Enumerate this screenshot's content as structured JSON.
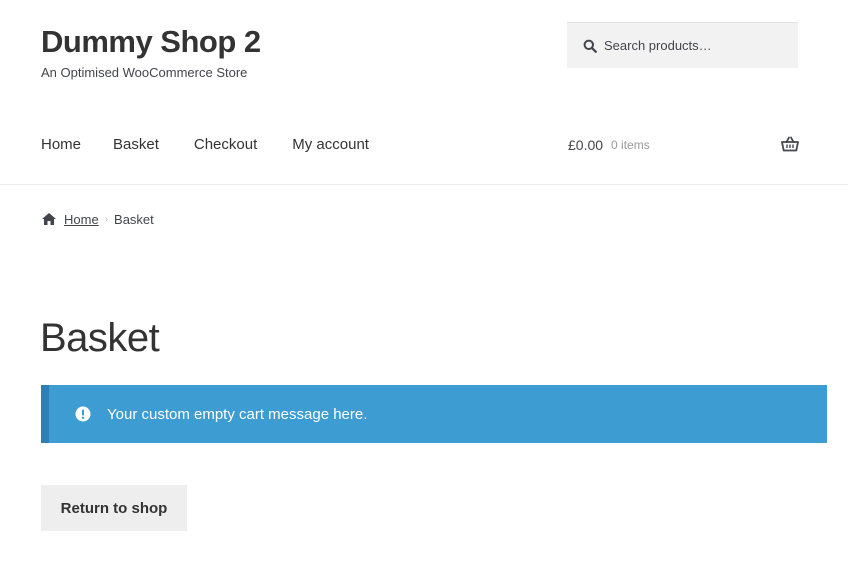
{
  "header": {
    "site_title": "Dummy Shop 2",
    "tagline": "An Optimised WooCommerce Store"
  },
  "search": {
    "placeholder": "Search products…",
    "value": "",
    "icon": "search-icon"
  },
  "nav": {
    "items": [
      {
        "label": "Home"
      },
      {
        "label": "Basket"
      },
      {
        "label": "Checkout"
      },
      {
        "label": "My account"
      }
    ]
  },
  "cart": {
    "amount": "£0.00",
    "count": "0 items",
    "icon": "basket-icon"
  },
  "breadcrumb": {
    "home": "Home",
    "current": "Basket",
    "separator": "›"
  },
  "main": {
    "title": "Basket",
    "notice": "Your custom empty cart message here.",
    "return_button": "Return to shop"
  },
  "colors": {
    "notice_bg": "#3d9cd2",
    "notice_border": "#2f7fb0",
    "button_bg": "#eeeeee",
    "search_bg": "#f2f2f2"
  }
}
